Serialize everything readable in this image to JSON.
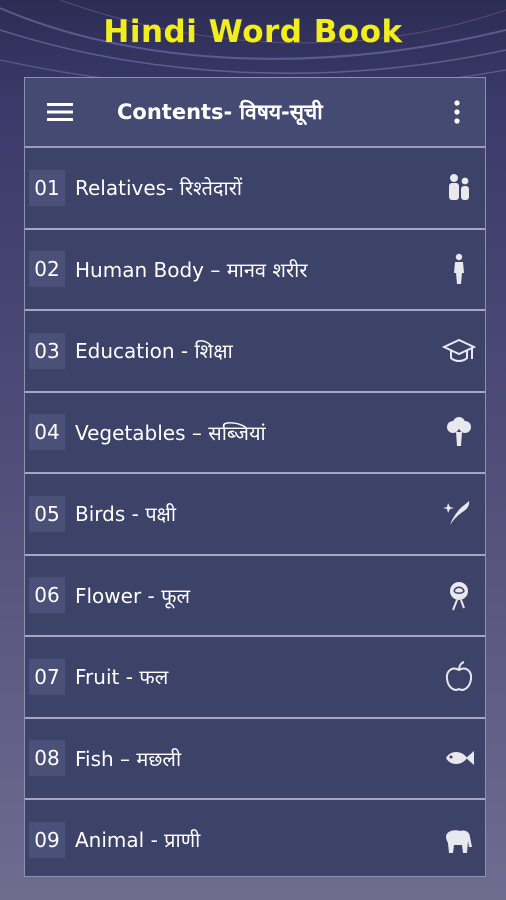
{
  "banner": {
    "title": "Hindi Word Book",
    "color": "#f2ee1e"
  },
  "toolbar": {
    "title": "Contents- विषय-सूची",
    "menu_icon": "hamburger-menu-icon",
    "more_icon": "more-vert-icon"
  },
  "items": [
    {
      "number": "01",
      "label": "Relatives- रिश्तेदारों",
      "icon": "family-icon"
    },
    {
      "number": "02",
      "label": "Human Body – मानव शरीर",
      "icon": "human-figure-icon"
    },
    {
      "number": "03",
      "label": "Education - शिक्षा",
      "icon": "graduation-cap-icon"
    },
    {
      "number": "04",
      "label": "Vegetables – सब्जियां",
      "icon": "broccoli-icon"
    },
    {
      "number": "05",
      "label": "Birds - पक्षी",
      "icon": "bird-icon"
    },
    {
      "number": "06",
      "label": "Flower - फूल",
      "icon": "rose-icon"
    },
    {
      "number": "07",
      "label": "Fruit - फल",
      "icon": "apple-icon"
    },
    {
      "number": "08",
      "label": "Fish – मछली",
      "icon": "fish-icon"
    },
    {
      "number": "09",
      "label": "Animal - प्राणी",
      "icon": "elephant-icon"
    }
  ]
}
